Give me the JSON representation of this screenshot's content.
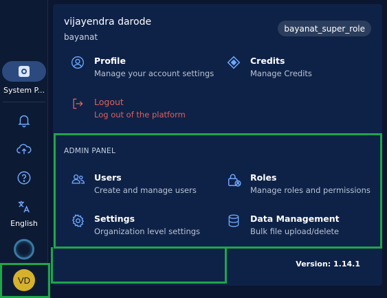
{
  "rail": {
    "system_label": "System P...",
    "language_label": "English",
    "avatar_initials": "VD"
  },
  "user": {
    "name": "vijayendra darode",
    "org": "bayanat",
    "role": "bayanat_super_role"
  },
  "menu": {
    "profile": {
      "title": "Profile",
      "desc": "Manage your account settings",
      "icon": "user-circle-icon"
    },
    "credits": {
      "title": "Credits",
      "desc": "Manage Credits",
      "icon": "diamond-icon"
    },
    "logout": {
      "title": "Logout",
      "desc": "Log out of the platform",
      "icon": "logout-icon"
    }
  },
  "admin": {
    "section_label": "ADMIN PANEL",
    "users": {
      "title": "Users",
      "desc": "Create and manage users",
      "icon": "users-icon"
    },
    "roles": {
      "title": "Roles",
      "desc": "Manage roles and permissions",
      "icon": "lock-user-icon"
    },
    "settings": {
      "title": "Settings",
      "desc": "Organization level settings",
      "icon": "gear-icon"
    },
    "data": {
      "title": "Data Management",
      "desc": "Bulk file upload/delete",
      "icon": "database-icon"
    }
  },
  "version_text": "Version: 1.14.1",
  "colors": {
    "panel": "#0e2247",
    "highlight": "#1fa64a",
    "logout": "#e06060",
    "accent": "#6fa8ff"
  }
}
